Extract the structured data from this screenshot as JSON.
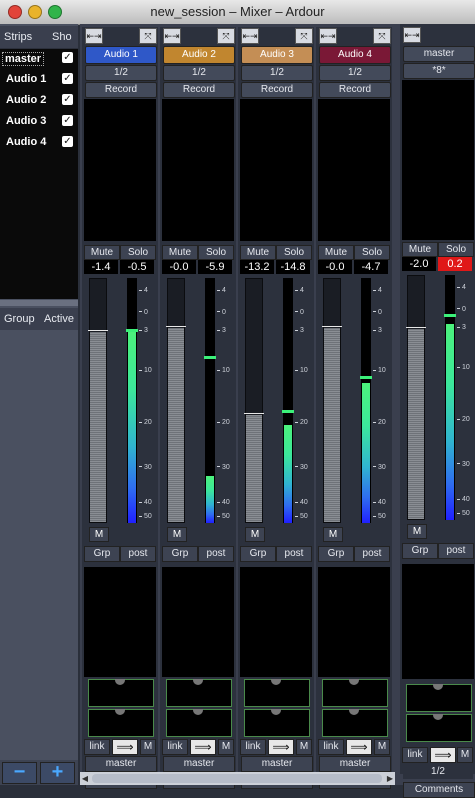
{
  "window": {
    "title": "new_session – Mixer – Ardour"
  },
  "left_panel": {
    "strips_header": "Strips",
    "show_header": "Sho",
    "strips": [
      {
        "name": "master",
        "selected": true
      },
      {
        "name": "Audio 1"
      },
      {
        "name": "Audio 2"
      },
      {
        "name": "Audio 3"
      },
      {
        "name": "Audio 4"
      }
    ],
    "group_header": "Group",
    "active_header": "Active",
    "minus_label": "−",
    "plus_label": "+"
  },
  "common": {
    "mute": "Mute",
    "solo": "Solo",
    "record": "Record",
    "input": "1/2",
    "m": "M",
    "grp": "Grp",
    "post": "post",
    "link": "link",
    "master_out": "master",
    "comments": "Comments",
    "scale": [
      "4",
      "0",
      "3",
      "10",
      "20",
      "30",
      "40",
      "50"
    ]
  },
  "strips": [
    {
      "name": "Audio 1",
      "color": "#2f58c8",
      "gain": "-1.4",
      "peak": "-0.5",
      "fader": 0.78,
      "meter": 0.78,
      "peakpos": 0.79
    },
    {
      "name": "Audio 2",
      "color": "#c1862f",
      "gain": "-0.0",
      "peak": "-5.9",
      "fader": 0.8,
      "meter": 0.19,
      "peakpos": 0.68
    },
    {
      "name": "Audio 3",
      "color": "#c48e55",
      "gain": "-13.2",
      "peak": "-14.8",
      "fader": 0.44,
      "meter": 0.4,
      "peakpos": 0.46
    },
    {
      "name": "Audio 4",
      "color": "#7a1836",
      "gain": "-0.0",
      "peak": "-4.7",
      "fader": 0.8,
      "meter": 0.57,
      "peakpos": 0.6
    }
  ],
  "master_strip": {
    "name": "master",
    "input": "*8*",
    "gain": "-2.0",
    "peak": "0.2",
    "peak_color": "#e01818",
    "fader": 0.78,
    "meter": 0.8,
    "peakpos": 0.84,
    "output": "1/2"
  }
}
